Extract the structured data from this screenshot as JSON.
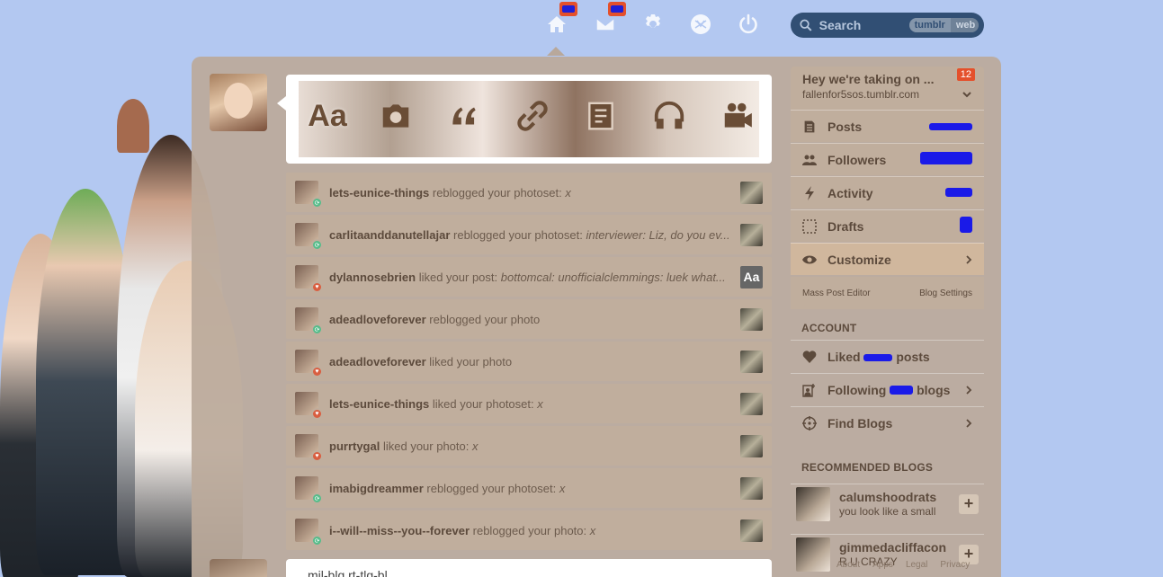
{
  "topnav": {
    "search_placeholder": "Search",
    "scope_tumblr": "tumblr",
    "scope_web": "web"
  },
  "composer": {
    "types": [
      "Aa"
    ]
  },
  "notifications": [
    {
      "user": "lets-eunice-things",
      "action": "reblogged your photoset:",
      "detail": "x",
      "kind": "reblog"
    },
    {
      "user": "carlitaanddanutellajar",
      "action": "reblogged your photoset:",
      "detail": "interviewer: Liz, do you ev...",
      "kind": "reblog"
    },
    {
      "user": "dylannosebrien",
      "action": "liked your post:",
      "detail": "bottomcal: unofficialclemmings: luek what...",
      "kind": "like",
      "thumb_text": "Aa"
    },
    {
      "user": "adeadloveforever",
      "action": "reblogged your photo",
      "detail": "",
      "kind": "reblog"
    },
    {
      "user": "adeadloveforever",
      "action": "liked your photo",
      "detail": "",
      "kind": "like"
    },
    {
      "user": "lets-eunice-things",
      "action": "liked your photoset:",
      "detail": "x",
      "kind": "like"
    },
    {
      "user": "purrtygal",
      "action": "liked your photo:",
      "detail": "x",
      "kind": "like"
    },
    {
      "user": "imabigdreammer",
      "action": "reblogged your photoset:",
      "detail": "x",
      "kind": "reblog"
    },
    {
      "user": "i--will--miss--you--forever",
      "action": "reblogged your photo:",
      "detail": "x",
      "kind": "reblog"
    }
  ],
  "bottom_post": {
    "text": "mil-blg rt-tlg-bl"
  },
  "sidebar": {
    "blog_title": "Hey we're taking on ...",
    "blog_url": "fallenfor5sos.tumblr.com",
    "blog_count": "12",
    "posts_label": "Posts",
    "followers_label": "Followers",
    "activity_label": "Activity",
    "drafts_label": "Drafts",
    "customize_label": "Customize",
    "mass_post_editor": "Mass Post Editor",
    "blog_settings": "Blog Settings",
    "account_label": "ACCOUNT",
    "liked_prefix": "Liked",
    "liked_suffix": "posts",
    "following_prefix": "Following",
    "following_suffix": "blogs",
    "find_blogs_label": "Find Blogs",
    "recommended_label": "RECOMMENDED BLOGS",
    "recommended": [
      {
        "name": "calumshoodrats",
        "sub": "you look like a small"
      },
      {
        "name": "gimmedacliffacon",
        "sub": "R U CRAZY"
      }
    ]
  },
  "footer": {
    "links": [
      "About",
      "Apps",
      "Legal",
      "Privacy"
    ]
  }
}
